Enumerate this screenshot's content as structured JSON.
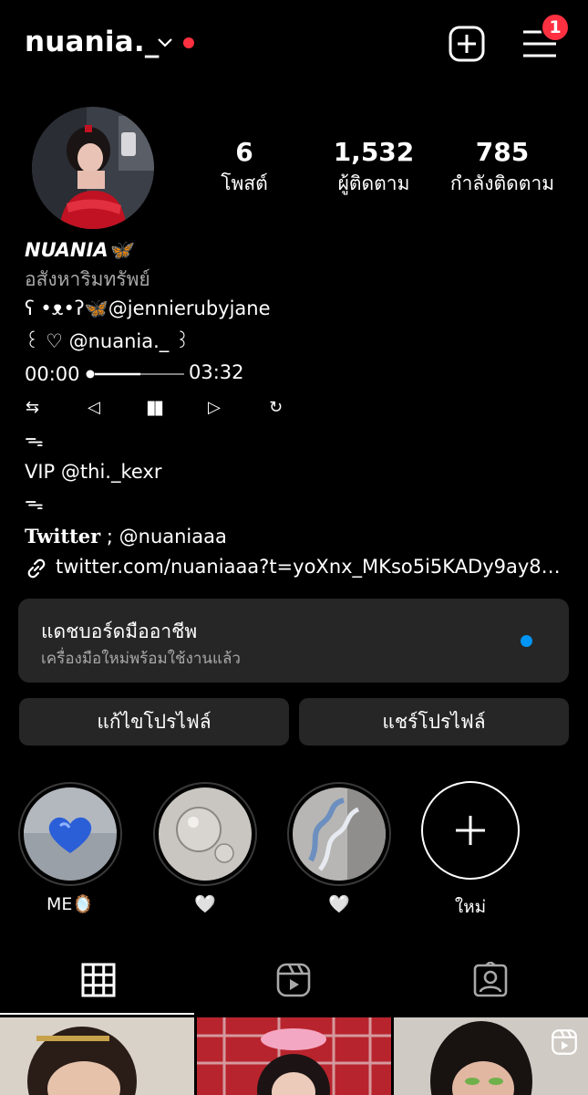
{
  "colors": {
    "accent_blue": "#0095f6",
    "badge_red": "#ff3040",
    "status_red": "#ff3040"
  },
  "header": {
    "username": "nuania._",
    "notification_count": "1",
    "icons": [
      "chevron-down-icon",
      "plus-square-icon",
      "hamburger-menu-icon"
    ]
  },
  "stats": [
    {
      "value": "6",
      "label": "โพสต์"
    },
    {
      "value": "1,532",
      "label": "ผู้ติดตาม"
    },
    {
      "value": "785",
      "label": "กำลังติดตาม"
    }
  ],
  "bio": {
    "name": "NUANIA🦋",
    "category": "อสังหาริมทรัพย์",
    "line1": "ʕ •ᴥ•ʔ🦋@jennierubyjane",
    "line2": "꒰ ♡ @nuania._ ꒱",
    "time_start": "00:00",
    "time_end": "03:32",
    "controls": [
      "⇆",
      "◁",
      "▮▮",
      "▷",
      "↻"
    ],
    "line4": "ᯓ",
    "line5": "VIP @thi._kexr",
    "line6": "ᯓ",
    "twitter_label": "Twitter",
    "twitter_rest": " ; @nuaniaaa",
    "link": "twitter.com/nuaniaaa?t=yoXnx_MKso5i5KADy9ay8Q..."
  },
  "dashboard": {
    "title": "แดชบอร์ดมืออาชีพ",
    "subtitle": "เครื่องมือใหม่พร้อมใช้งานแล้ว"
  },
  "buttons": {
    "edit_profile": "แก้ไขโปรไฟล์",
    "share_profile": "แชร์โปรไฟล์"
  },
  "highlights": [
    {
      "label": "ME🪞"
    },
    {
      "label": "🤍"
    },
    {
      "label": "🤍"
    },
    {
      "label": "ใหม่"
    }
  ],
  "tabs": [
    "grid-icon",
    "reels-icon",
    "tagged-icon"
  ]
}
